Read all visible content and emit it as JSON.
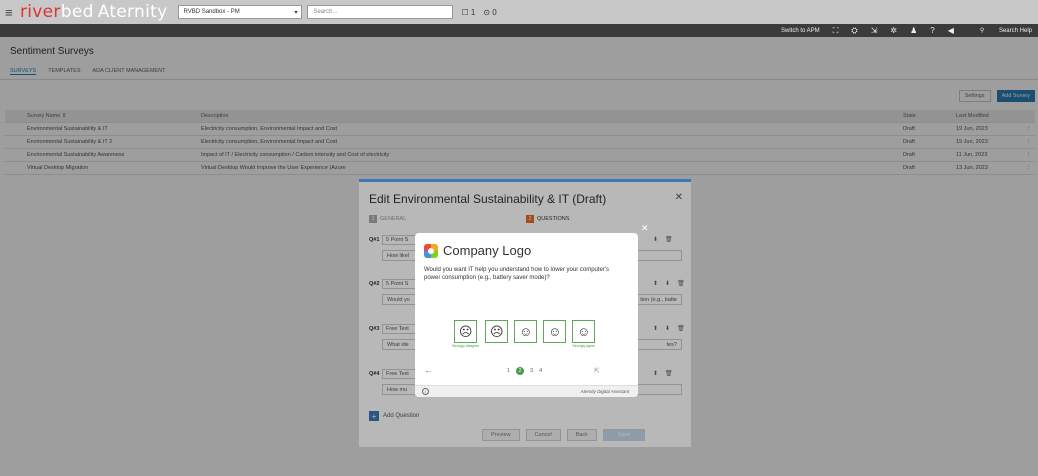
{
  "topbar": {
    "menu_icon": "hamburger-icon",
    "logo_part1": "river",
    "logo_part2": "bed",
    "logo_app": "Aternity",
    "account_select": "RVBD Sandbox - PM",
    "select_chevron": "▾",
    "search_placeholder": "Search...",
    "alerts_count": "1",
    "tasks_count": "0"
  },
  "subbar": {
    "switch_label": "Switch to APM",
    "help_label": "Search Help",
    "icons": [
      "grid-icon",
      "dashboard-icon",
      "export-icon",
      "gear-icon",
      "user-icon",
      "help-icon",
      "megaphone-icon",
      "search-icon"
    ]
  },
  "page": {
    "title": "Sentiment Surveys",
    "tabs": [
      "SURVEYS",
      "TEMPLATES",
      "ADA CLIENT MANAGEMENT"
    ],
    "settings_label": "Settings",
    "add_label": "Add Survey"
  },
  "table": {
    "headers": [
      "Survey Name",
      "Description",
      "State",
      "Last Modified"
    ],
    "rows": [
      [
        "Environmental Sustainability & IT",
        "Electricity consumption, Environmental Impact and Cost",
        "Draft",
        "19 Jun, 2023"
      ],
      [
        "Environmental Sustainability & IT 2",
        "Electricity consumption, Environmental Impact and Cost",
        "Draft",
        "19 Jun, 2023"
      ],
      [
        "Environmental Sustainability Awareness",
        "Impact of IT / Electricity consumption / Carbon intensity and Cost of electricity",
        "Draft",
        "11 Jun, 2023"
      ],
      [
        "Virtual Desktop Migration",
        "Virtual Desktop Would Improve the User Experience (Azure",
        "Draft",
        "13 Jun, 2023"
      ]
    ]
  },
  "dialog": {
    "title": "Edit Environmental Sustainability & IT (Draft)",
    "step1_num": "1",
    "step1": "GENERAL",
    "step2_num": "2",
    "step2": "QUESTIONS",
    "questions": [
      {
        "label": "Q#1",
        "type": "5 Point S",
        "text": "How likel",
        "tail": ""
      },
      {
        "label": "Q#2",
        "type": "5 Point S",
        "text": "Would yo",
        "tail": "tion (e.g., batte"
      },
      {
        "label": "Q#3",
        "type": "Free Text",
        "text": "What ide",
        "tail": "tes?"
      },
      {
        "label": "Q#4",
        "type": "Free Text",
        "text": "How mu",
        "tail": ""
      }
    ],
    "add_question": "Add Question",
    "preview": "Preview",
    "cancel": "Cancel",
    "back": "Back",
    "save": "Save"
  },
  "popup": {
    "logo_text": "Company Logo",
    "question": "Would you want IT help you understand how to lower your computer's power consumption (e.g., battery saver mode)?",
    "low_label": "Strongly disagree",
    "high_label": "Strongly agree",
    "pages": [
      "1",
      "2",
      "3",
      "4"
    ],
    "current_page": "2",
    "footer_brand": "Aternity Digital Assistant"
  }
}
